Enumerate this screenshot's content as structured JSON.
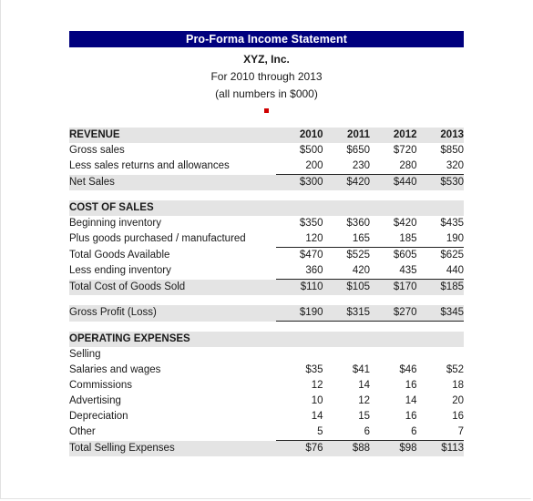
{
  "document": {
    "title": "Pro-Forma Income Statement",
    "company": "XYZ, Inc.",
    "period": "For 2010 through 2013",
    "units_note": "(all numbers in $000)",
    "header_bar_color": "#00007e",
    "band_color": "#e4e4e4",
    "marker_color": "#d00000"
  },
  "columns": {
    "label_header": "",
    "years": [
      "2010",
      "2011",
      "2012",
      "2013"
    ]
  },
  "sections": [
    {
      "id": "revenue",
      "heading": "REVENUE",
      "rows": [
        {
          "label": "Gross sales",
          "indent": 0,
          "values": [
            "$500",
            "$650",
            "$720",
            "$850"
          ],
          "style": "plain"
        },
        {
          "label": "Less sales returns and allowances",
          "indent": 1,
          "values": [
            "200",
            "230",
            "280",
            "320"
          ],
          "style": "plain"
        },
        {
          "label": "Net Sales",
          "indent": 0,
          "values": [
            "$300",
            "$420",
            "$440",
            "$530"
          ],
          "style": "total"
        }
      ]
    },
    {
      "id": "cost-of-sales",
      "heading": "COST OF SALES",
      "rows": [
        {
          "label": "Beginning inventory",
          "indent": 0,
          "values": [
            "$350",
            "$360",
            "$420",
            "$435"
          ],
          "style": "plain"
        },
        {
          "label": "Plus goods purchased / manufactured",
          "indent": 1,
          "values": [
            "120",
            "165",
            "185",
            "190"
          ],
          "style": "plain"
        },
        {
          "label": "Total Goods Available",
          "indent": 0,
          "values": [
            "$470",
            "$525",
            "$605",
            "$625"
          ],
          "style": "subtotal"
        },
        {
          "label": "Less ending inventory",
          "indent": 1,
          "values": [
            "360",
            "420",
            "435",
            "440"
          ],
          "style": "plain"
        },
        {
          "label": "Total Cost of Goods Sold",
          "indent": 0,
          "values": [
            "$110",
            "$105",
            "$170",
            "$185"
          ],
          "style": "total"
        }
      ]
    },
    {
      "id": "gross-profit",
      "heading": "",
      "rows": [
        {
          "label": "Gross Profit (Loss)",
          "indent": 0,
          "values": [
            "$190",
            "$315",
            "$270",
            "$345"
          ],
          "style": "grossprofit"
        }
      ]
    },
    {
      "id": "operating-expenses",
      "heading": "OPERATING EXPENSES",
      "rows": [
        {
          "label": "Selling",
          "indent": 0,
          "values": [
            "",
            "",
            "",
            ""
          ],
          "style": "plain"
        },
        {
          "label": "Salaries and wages",
          "indent": 2,
          "values": [
            "$35",
            "$41",
            "$46",
            "$52"
          ],
          "style": "plain"
        },
        {
          "label": "Commissions",
          "indent": 2,
          "values": [
            "12",
            "14",
            "16",
            "18"
          ],
          "style": "plain"
        },
        {
          "label": "Advertising",
          "indent": 2,
          "values": [
            "10",
            "12",
            "14",
            "20"
          ],
          "style": "plain"
        },
        {
          "label": "Depreciation",
          "indent": 2,
          "values": [
            "14",
            "15",
            "16",
            "16"
          ],
          "style": "plain"
        },
        {
          "label": "Other",
          "indent": 2,
          "values": [
            "5",
            "6",
            "6",
            "7"
          ],
          "style": "plain"
        },
        {
          "label": "Total Selling Expenses",
          "indent": 0,
          "values": [
            "$76",
            "$88",
            "$98",
            "$113"
          ],
          "style": "total"
        }
      ]
    }
  ]
}
